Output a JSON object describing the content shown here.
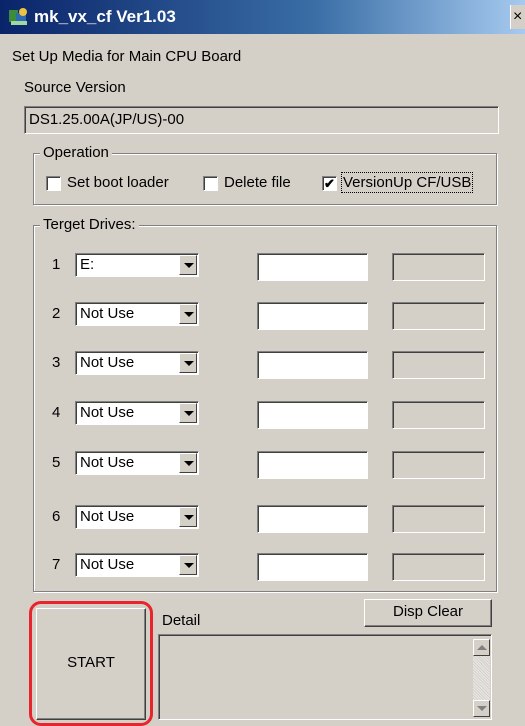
{
  "window": {
    "title": "mk_vx_cf Ver1.03",
    "close_label": "×"
  },
  "heading": "Set Up Media for Main CPU Board",
  "source": {
    "label": "Source Version",
    "value": "DS1.25.00A(JP/US)-00"
  },
  "operation": {
    "group_label": "Operation",
    "options": [
      {
        "label": "Set boot loader",
        "checked": false
      },
      {
        "label": "Delete file",
        "checked": false
      },
      {
        "label": "VersionUp CF/USB",
        "checked": true
      }
    ],
    "check_mark": "✔"
  },
  "drives": {
    "group_label": "Terget Drives:",
    "rows": [
      {
        "num": "1",
        "value": "E:"
      },
      {
        "num": "2",
        "value": "Not Use"
      },
      {
        "num": "3",
        "value": "Not Use"
      },
      {
        "num": "4",
        "value": "Not Use"
      },
      {
        "num": "5",
        "value": "Not Use"
      },
      {
        "num": "6",
        "value": "Not Use"
      },
      {
        "num": "7",
        "value": "Not Use"
      }
    ]
  },
  "start_label": "START",
  "detail_label": "Detail",
  "disp_clear_label": "Disp Clear",
  "colors": {
    "highlight": "#e8242c",
    "window_bg": "#d4d0c8",
    "title_bar": "#0a246a"
  }
}
